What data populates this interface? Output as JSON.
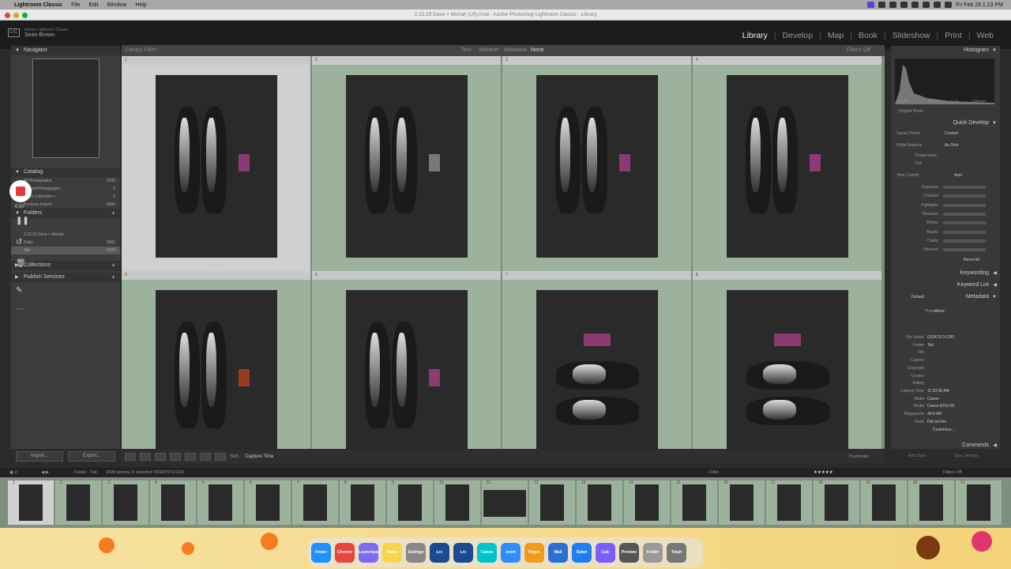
{
  "menubar": {
    "apple": "",
    "app": "Lightroom Classic",
    "items": [
      "File",
      "Edit",
      "Window",
      "Help"
    ],
    "datetime": "Fri Feb 28  1:13 PM"
  },
  "window": {
    "title": "2.22.25 Dave + Moriah (LR).lrcat - Adobe Photoshop Lightroom Classic - Library"
  },
  "identity": {
    "badge": "LrC",
    "product": "Adobe Lightroom Classic",
    "user": "Sean Brown"
  },
  "modules": [
    "Library",
    "Develop",
    "Map",
    "Book",
    "Slideshow",
    "Print",
    "Web"
  ],
  "active_module": "Library",
  "left": {
    "navigator": "Navigator",
    "catalog": "Catalog",
    "catalog_rows": [
      {
        "label": "All Photographs",
        "count": "5590"
      },
      {
        "label": "Synced Photographs",
        "count": "0"
      },
      {
        "label": "Quick Collection +",
        "count": "0"
      },
      {
        "label": "Previous Import",
        "count": "5590"
      }
    ],
    "folders": "Folders",
    "folder_rows": [
      {
        "label": "2.22.25 Dave + Moriah",
        "count": ""
      },
      {
        "label": "Gaby",
        "count": "3562"
      },
      {
        "label": "Tati",
        "count": "2028"
      }
    ],
    "collections": "Collections",
    "publish": "Publish Services",
    "import": "Import...",
    "export": "Export..."
  },
  "recorder": {
    "time": "0:00"
  },
  "filterbar": {
    "title": "Library Filter :",
    "tabs": [
      "Text",
      "Attribute",
      "Metadata",
      "None"
    ],
    "active": "None",
    "right": "Filters Off"
  },
  "grid": [
    {
      "n": "1",
      "sel": true
    },
    {
      "n": "2",
      "sel": false
    },
    {
      "n": "3",
      "sel": false
    },
    {
      "n": "4",
      "sel": false
    },
    {
      "n": "5",
      "sel": false
    },
    {
      "n": "6",
      "sel": false
    },
    {
      "n": "7",
      "sel": false
    },
    {
      "n": "8",
      "sel": false
    }
  ],
  "toolbar": {
    "sort_label": "Sort :",
    "sort_value": "Capture Time",
    "thumbs": "Thumbnails"
  },
  "right": {
    "histogram": "Histogram",
    "hist_info": [
      "ISO 640",
      "85 mm",
      "f / 2.8",
      "1/250 sec"
    ],
    "original": "Original Photo",
    "quick_develop": "Quick Develop",
    "saved_preset": "Saved Preset",
    "saved_preset_val": "Custom",
    "white_balance": "White Balance",
    "wb_val": "As Shot",
    "temperature": "Temperature",
    "tint": "Tint",
    "tone_control": "Tone Control",
    "auto": "Auto",
    "tone_rows": [
      "Exposure",
      "Contrast",
      "Highlights",
      "Shadows",
      "Whites",
      "Blacks",
      "Clarity",
      "Vibrance"
    ],
    "reset": "Reset All",
    "keywording": "Keywording",
    "keyword_list": "Keyword List",
    "metadata": "Metadata",
    "meta_default": "Default",
    "preset": "Preset",
    "preset_val": "None",
    "meta": [
      {
        "k": "File Name",
        "v": "032A7573.CR3"
      },
      {
        "k": "Folder",
        "v": "Tati"
      },
      {
        "k": "Title",
        "v": ""
      },
      {
        "k": "Caption",
        "v": ""
      },
      {
        "k": "Copyright",
        "v": ""
      },
      {
        "k": "Creator",
        "v": ""
      },
      {
        "k": "Rating",
        "v": ""
      },
      {
        "k": "Capture Time",
        "v": "11:20:58 AM"
      },
      {
        "k": "Make",
        "v": "Canon"
      },
      {
        "k": "Model",
        "v": "Canon EOS R5"
      },
      {
        "k": "Megapixels",
        "v": "44.8 MP"
      },
      {
        "k": "Flash",
        "v": "Did not fire"
      }
    ],
    "customize": "Customize...",
    "comments": "Comments",
    "sync": "Auto Sync",
    "sync_settings": "Sync Settings"
  },
  "filmstrip": {
    "path": "Folder : Tati",
    "count": "2028 photos /1 selected /032A7573.CR3",
    "filter": "Filter :",
    "filters_off": "Filters Off",
    "frames": [
      "1",
      "2",
      "3",
      "4",
      "5",
      "6",
      "7",
      "8",
      "9",
      "10",
      "11",
      "12",
      "13",
      "14",
      "15",
      "16",
      "17",
      "18",
      "19",
      "20",
      "21"
    ],
    "selected_index": 0
  },
  "dock": {
    "apps": [
      "Finder",
      "Chrome",
      "Launchpad",
      "Notes",
      "Settings",
      "Lrc",
      "Lrc",
      "Canva",
      "zoom",
      "Pages",
      "Mail",
      "Safari",
      "Calc",
      "Preview",
      "Folder",
      "Trash"
    ]
  }
}
